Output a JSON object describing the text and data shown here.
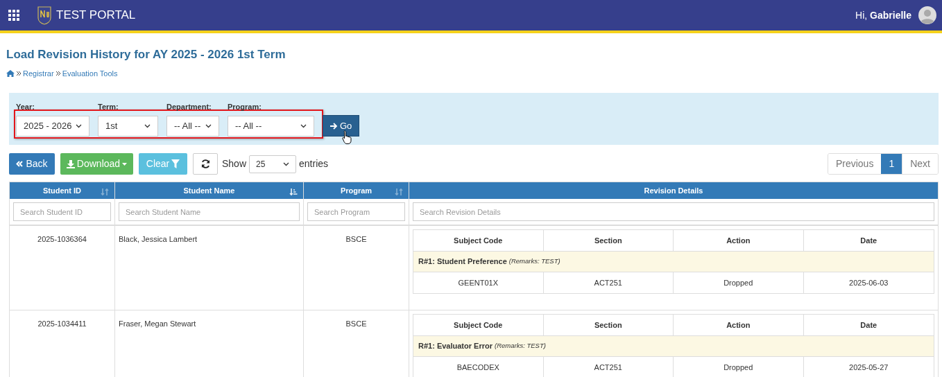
{
  "header": {
    "app_title": "TEST PORTAL",
    "greeting": "Hi,",
    "user_name": "Gabrielle"
  },
  "page": {
    "title": "Load Revision History for AY 2025 - 2026 1st Term",
    "breadcrumb": [
      "Registrar",
      "Evaluation Tools"
    ]
  },
  "filters": [
    {
      "label": "Year:",
      "value": "2025 - 2026"
    },
    {
      "label": "Term:",
      "value": "1st"
    },
    {
      "label": "Department:",
      "value": "-- All --"
    },
    {
      "label": "Program:",
      "value": "-- All --"
    }
  ],
  "go_button": "Go",
  "toolbar": {
    "back": "Back",
    "download": "Download",
    "clear": "Clear",
    "show_label": "Show",
    "entries_value": "25",
    "entries_label": "entries"
  },
  "pagination": {
    "previous": "Previous",
    "pages": [
      {
        "label": "1",
        "selected": true
      }
    ],
    "next": "Next"
  },
  "table": {
    "columns": [
      {
        "label": "Student ID",
        "kind": "sortable",
        "placeholder": "Search Student ID"
      },
      {
        "label": "Student Name",
        "kind": "sorted",
        "placeholder": "Search Student Name"
      },
      {
        "label": "Program",
        "kind": "sortable",
        "placeholder": "Search Program"
      },
      {
        "label": "Revision Details",
        "kind": "plain",
        "placeholder": "Search Revision Details"
      }
    ],
    "rows": [
      {
        "student_id": "2025-1036364",
        "name": "Black, Jessica Lambert",
        "program": "BSCE",
        "detail_columns": [
          "Subject Code",
          "Section",
          "Action",
          "Date"
        ],
        "revisions": [
          {
            "label": "R#1: Student Preference",
            "remarks": "(Remarks: TEST)",
            "items": [
              {
                "subject_code": "GEENT01X",
                "section": "ACT251",
                "action": "Dropped",
                "date": "2025-06-03"
              }
            ]
          }
        ]
      },
      {
        "student_id": "2025-1034411",
        "name": "Fraser, Megan Stewart",
        "program": "BSCE",
        "detail_columns": [
          "Subject Code",
          "Section",
          "Action",
          "Date"
        ],
        "revisions": [
          {
            "label": "R#1: Evaluator Error",
            "remarks": "(Remarks: TEST)",
            "items": [
              {
                "subject_code": "BAECODEX",
                "section": "ACT251",
                "action": "Dropped",
                "date": "2025-05-27"
              }
            ]
          }
        ]
      }
    ]
  }
}
